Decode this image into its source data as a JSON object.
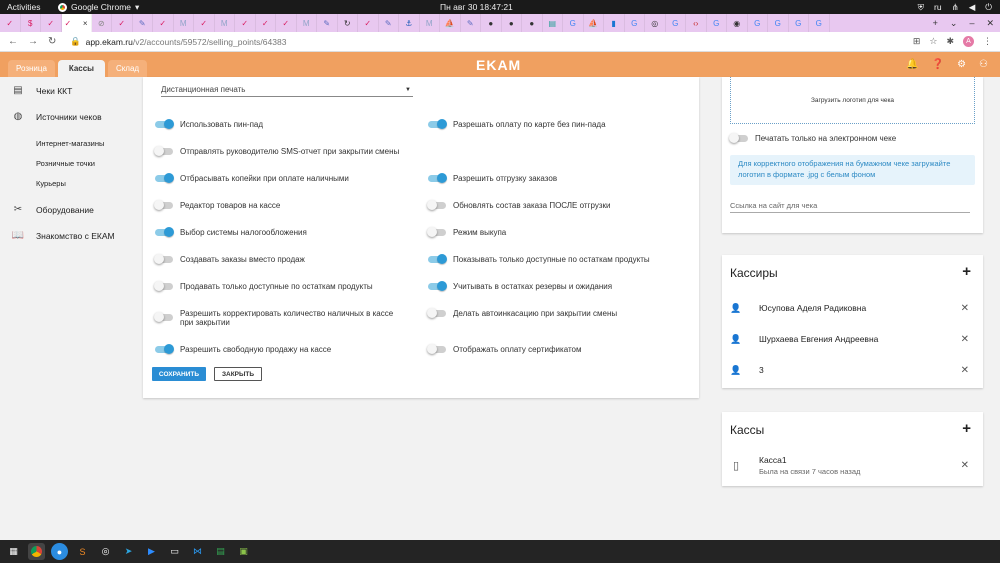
{
  "gnome": {
    "activities": "Activities",
    "app_name": "Google Chrome",
    "clock": "Пн авг 30  18:47:21",
    "lang": "ru"
  },
  "browser": {
    "url_host": "app.ekam.ru",
    "url_path": "/v2/accounts/59572/selling_points/64383",
    "profile_initial": "A"
  },
  "app": {
    "logo": "EKAM",
    "tabs": [
      {
        "label": "Розница"
      },
      {
        "label": "Кассы"
      },
      {
        "label": "Склад"
      }
    ]
  },
  "sidebar": {
    "items": [
      {
        "label": "Чеки ККТ",
        "icon": "receipt-icon"
      },
      {
        "label": "Источники чеков",
        "icon": "globe-icon"
      },
      {
        "label": "Оборудование",
        "icon": "tools-icon"
      },
      {
        "label": "Знакомство с ЕКАМ",
        "icon": "book-icon"
      }
    ],
    "sub_items": [
      {
        "label": "Интернет-магазины"
      },
      {
        "label": "Розничные точки"
      },
      {
        "label": "Курьеры"
      }
    ]
  },
  "settings": {
    "print_mode": "Дистанционная печать",
    "left": [
      {
        "label": "Использовать пин-пад",
        "on": true
      },
      {
        "label": "Отправлять руководителю SMS-отчет при закрытии смены",
        "on": false
      },
      {
        "label": "Отбрасывать копейки при оплате наличными",
        "on": true
      },
      {
        "label": "Редактор товаров на кассе",
        "on": false
      },
      {
        "label": "Выбор системы налогообложения",
        "on": true
      },
      {
        "label": "Создавать заказы вместо продаж",
        "on": false
      },
      {
        "label": "Продавать только доступные по остаткам продукты",
        "on": false
      },
      {
        "label": "Разрешить корректировать количество наличных в кассе при закрытии",
        "on": false
      },
      {
        "label": "Разрешить свободную продажу на кассе",
        "on": true
      }
    ],
    "right": [
      {
        "label": "Разрешать оплату по карте без пин-пада",
        "on": true
      },
      {
        "label": "Разрешить отгрузку заказов",
        "on": true
      },
      {
        "label": "Обновлять состав заказа ПОСЛЕ отгрузки",
        "on": false
      },
      {
        "label": "Режим выкупа",
        "on": false
      },
      {
        "label": "Показывать только доступные по остаткам продукты",
        "on": true
      },
      {
        "label": "Учитывать в остатках резервы и ожидания",
        "on": true
      },
      {
        "label": "Делать автоинкасацию при закрытии смены",
        "on": false
      },
      {
        "label": "Отображать оплату сертификатом",
        "on": false
      }
    ],
    "save_label": "СОХРАНИТЬ",
    "close_label": "ЗАКРЫТЬ"
  },
  "receipt": {
    "upload_label": "Загрузить логотип для чека",
    "electronic_only_label": "Печатать только на электронном чеке",
    "electronic_only_on": false,
    "info": "Для корректного отображения на бумажном чеке загружайте логотип в формате .jpg с белым фоном",
    "site_placeholder": "Ссылка на сайт для чека"
  },
  "cashiers": {
    "title": "Кассиры",
    "list": [
      {
        "name": "Юсупова Аделя Радиковна"
      },
      {
        "name": "Шурхаева Евгения Андреевна"
      },
      {
        "name": "3"
      }
    ]
  },
  "registers": {
    "title": "Кассы",
    "list": [
      {
        "name": "Касса1",
        "status": "Была на связи 7 часов назад"
      }
    ]
  },
  "colors": {
    "header": "#f0a060",
    "accent": "#2d9ad6",
    "info_bg": "#e6f3fb"
  }
}
